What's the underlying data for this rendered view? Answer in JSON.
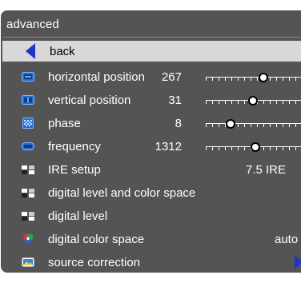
{
  "menu": {
    "title": "advanced",
    "items": [
      {
        "label": "back",
        "icon": "back-arrow-icon",
        "selected": true
      },
      {
        "label": "horizontal position",
        "value": "267",
        "icon": "horizontal-position-icon",
        "slider": 0.6
      },
      {
        "label": "vertical position",
        "value": "31",
        "icon": "vertical-position-icon",
        "slider": 0.5
      },
      {
        "label": "phase",
        "value": "8",
        "icon": "phase-icon",
        "slider": 0.25
      },
      {
        "label": "frequency",
        "value": "1312",
        "icon": "frequency-icon",
        "slider": 0.52
      },
      {
        "label": "IRE setup",
        "value": "7.5 IRE",
        "icon": "ire-setup-icon"
      },
      {
        "label": "digital level and color space",
        "icon": "digital-level-color-space-icon"
      },
      {
        "label": "digital level",
        "icon": "digital-level-icon"
      },
      {
        "label": "digital color space",
        "value": "auto",
        "icon": "digital-color-space-icon"
      },
      {
        "label": "source correction",
        "icon": "source-correction-icon",
        "submenu_icon": "chevron-right-icon"
      }
    ]
  },
  "colors": {
    "panel": "#545454",
    "selected_row": "#d8d8d8",
    "icon_blue": "#1e6fd6",
    "back_arrow": "#2233cc"
  }
}
